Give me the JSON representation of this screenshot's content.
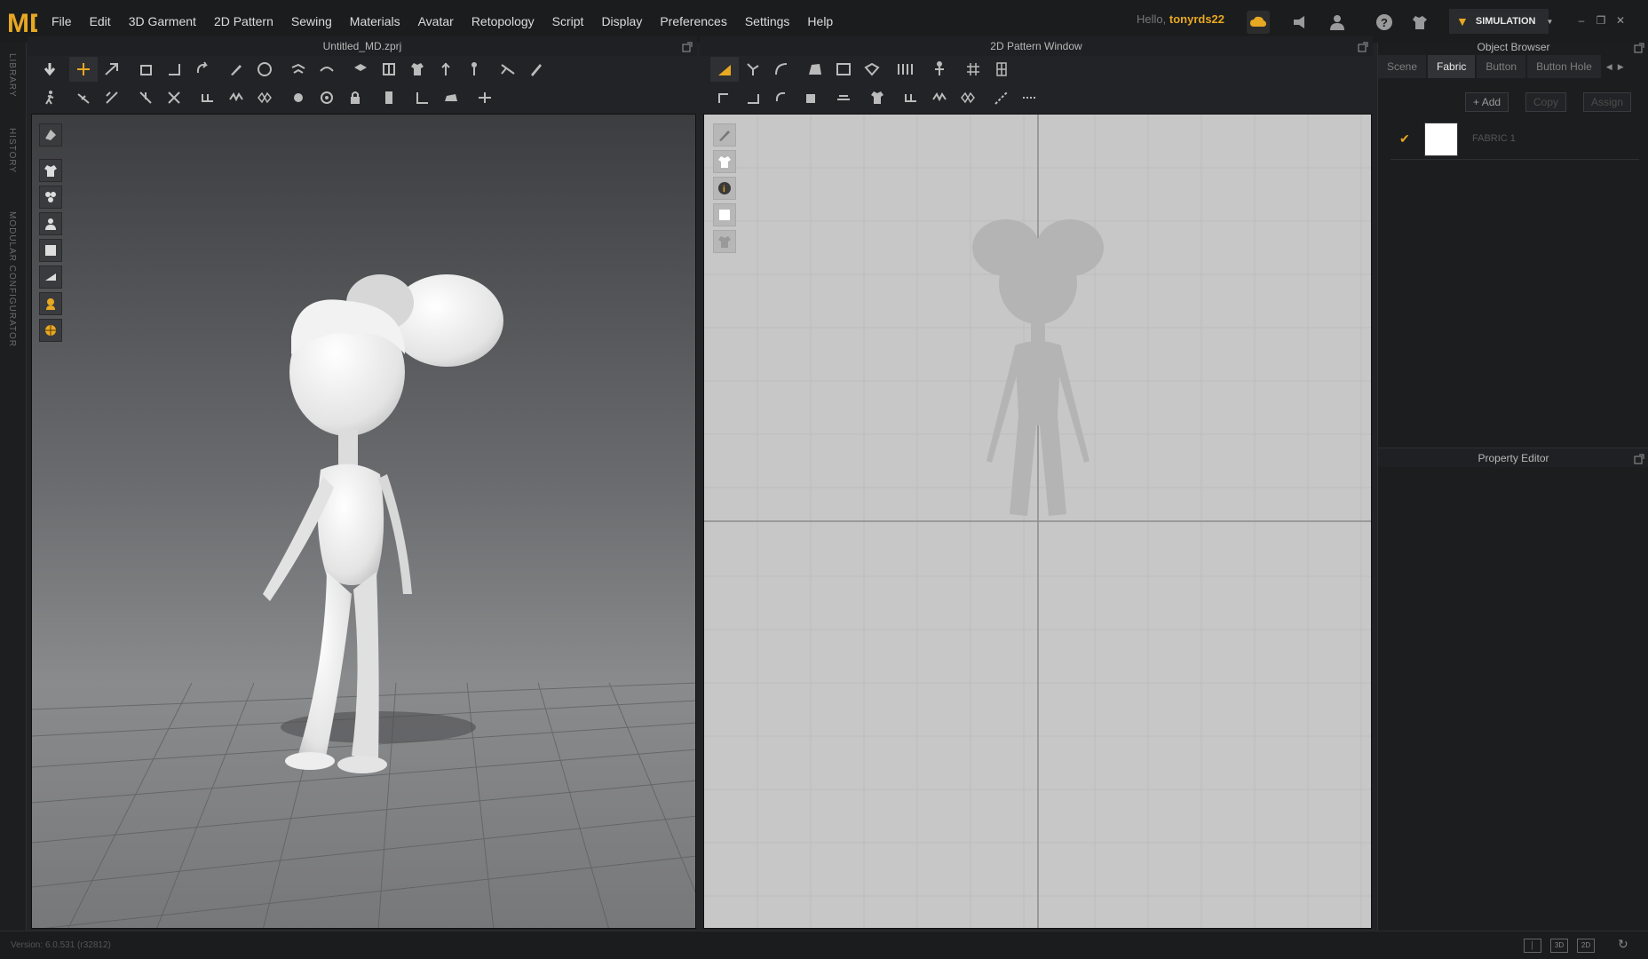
{
  "app": {
    "logo": "MD",
    "menu": [
      "File",
      "Edit",
      "3D Garment",
      "2D Pattern",
      "Sewing",
      "Materials",
      "Avatar",
      "Retopology",
      "Script",
      "Display",
      "Preferences",
      "Settings",
      "Help"
    ],
    "greeting": "Hello,",
    "username": "tonyrds22",
    "mode_label": "SIMULATION",
    "accent": "#e7a822"
  },
  "left_tabs": [
    "LIBRARY",
    "HISTORY",
    "MODULAR CONFIGURATOR"
  ],
  "viewport3d": {
    "title": "Untitled_MD.zprj"
  },
  "viewport2d": {
    "title": "2D Pattern Window"
  },
  "object_browser": {
    "title": "Object Browser",
    "tabs": [
      "Scene",
      "Fabric",
      "Button",
      "Button Hole"
    ],
    "active_tab": "Fabric",
    "add_label": "Add",
    "copy_label": "Copy",
    "assign_label": "Assign",
    "fabrics": [
      {
        "name": "FABRIC 1",
        "color": "#ffffff",
        "checked": true
      }
    ]
  },
  "property_editor": {
    "title": "Property Editor"
  },
  "status": {
    "version": "Version: 6.0.531 (r32812)",
    "view_3d_label": "3D",
    "view_2d_label": "2D"
  }
}
